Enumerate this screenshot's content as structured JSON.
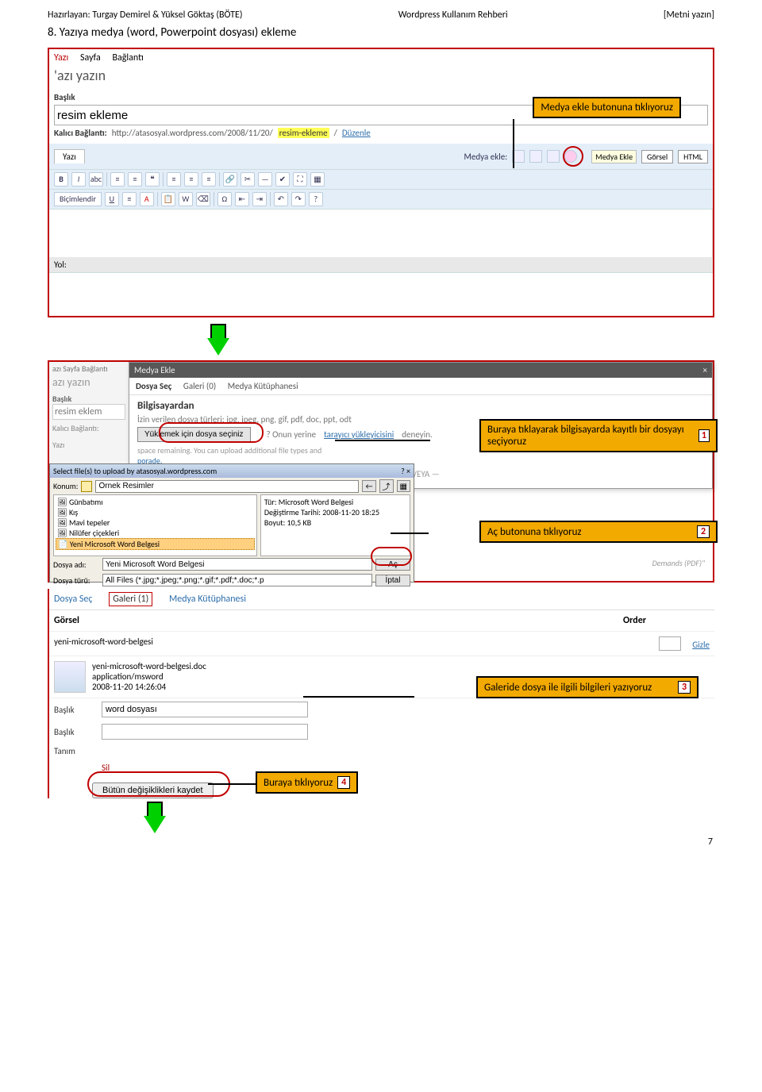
{
  "header": {
    "left": "Hazırlayan: Turgay Demirel & Yüksel Göktaş (BÖTE)",
    "center": "Wordpress Kullanım Rehberi",
    "right": "[Metni yazın]"
  },
  "section_title": "8.  Yazıya medya (word, Powerpoint dosyası) ekleme",
  "callouts": {
    "c1": "Medya ekle butonuna tıklıyoruz",
    "c2": "Buraya tıklayarak bilgisayarda kayıtlı bir dosyayı seçiyoruz",
    "c3": "Aç butonuna tıklıyoruz",
    "c4": "Galeride dosya ile ilgili bilgileri yazıyoruz",
    "c5": "Buraya tıklıyoruz"
  },
  "steps": {
    "s1": "1",
    "s2": "2",
    "s3": "3",
    "s4": "4"
  },
  "wp": {
    "tabs": {
      "yazi": "Yazı",
      "sayfa": "Sayfa",
      "baglanti": "Bağlantı"
    },
    "subheading": "'azı yazın",
    "baslik_label": "Başlık",
    "baslik_value": "resim ekleme",
    "permalink_label": "Kalıcı Bağlantı:",
    "permalink_url": "http://atasosyal.wordpress.com/2008/11/20/",
    "permalink_slug": "resim-ekleme",
    "permalink_edit": "Düzenle",
    "editor_tab_yazi": "Yazı",
    "media_label": "Medya ekle:",
    "media_tooltip": "Medya Ekle",
    "tab_visual": "Görsel",
    "tab_html": "HTML",
    "bicimlendir": "Biçimlendir",
    "yol": "Yol:"
  },
  "shot2": {
    "tabs": {
      "sayfa": "Sayfa",
      "baglanti": "Bağlantı"
    },
    "sub": "azı yazın",
    "baslik_label": "Başlık",
    "baslik_value": "resim eklem",
    "permalink": "Kalıcı Bağlantı:",
    "yazi": "Yazı"
  },
  "modal": {
    "title": "Medya Ekle",
    "close": "×",
    "tab1": "Dosya Seç",
    "tab2": "Galeri (0)",
    "tab3": "Medya Kütüphanesi",
    "from": "Bilgisayardan",
    "allowed": "İzin verilen dosya türleri: jpg, jpeg, png, gif, pdf, doc, ppt, odt",
    "btn": "Yüklemek için dosya seçiniz",
    "alt_hint": "? Onun yerine",
    "alt_link1": "tarayıcı yükleyicisini",
    "alt_link2": "deneyin.",
    "space1": "space remaining. You can upload additional file types and",
    "space2": "porade.",
    "veya": "— VEYA —"
  },
  "sys": {
    "title": "Select file(s) to upload by atasosyal.wordpress.com",
    "konum": "Konum:",
    "konum_val": "Örnek Resimler",
    "list": {
      "i1": "Günbatımı",
      "i2": "Kış",
      "i3": "Mavi tepeler",
      "i4": "Nilüfer çiçekleri",
      "i5": "Yeni Microsoft Word Belgesi"
    },
    "filetype": "Tür: Microsoft Word Belgesi",
    "filedate": "Değiştirme Tarihi: 2008-11-20 18:25",
    "filesize": "Boyut: 10,5 KB",
    "fname_label": "Dosya adı:",
    "fname_val": "Yeni Microsoft Word Belgesi",
    "ftype_label": "Dosya türü:",
    "ftype_val": "All Files (*.jpg;*.jpeg;*.png;*.gif;*.pdf;*.doc;*.p",
    "open": "Aç",
    "cancel": "İptal",
    "demands": "Demands (PDF)\""
  },
  "gal": {
    "tab1": "Dosya Seç",
    "tab2": "Galeri (1)",
    "tab3": "Medya Kütüphanesi",
    "col1": "Görsel",
    "col2": "Order",
    "rowtitle": "yeni-microsoft-word-belgesi",
    "filename": "yeni-microsoft-word-belgesi.doc",
    "mime": "application/msword",
    "date": "2008-11-20 14:26:04",
    "hide": "Gizle",
    "f_baslik": "Başlık",
    "f_baslik_val": "word dosyası",
    "f_baslik2": "Başlık",
    "f_tanim": "Tanım",
    "sil": "Sil",
    "save": "Bütün değişiklikleri kaydet"
  },
  "page_number": "7"
}
